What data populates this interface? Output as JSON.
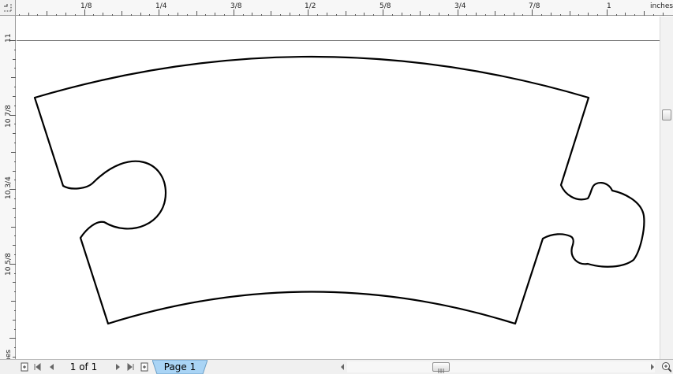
{
  "ruler": {
    "unit": "inches",
    "top_ticks": [
      "1/8",
      "1/4",
      "3/8",
      "1/2",
      "5/8",
      "3/4",
      "7/8",
      "1"
    ],
    "left_ticks": [
      "11",
      "10 7/8",
      "10 3/4",
      "10 5/8"
    ]
  },
  "status": {
    "page_count": "1 of 1",
    "page_tab": "Page 1"
  },
  "icons": {
    "add_page_before": "add-page-icon",
    "first": "first-page-icon",
    "prev": "previous-page-icon",
    "next": "next-page-icon",
    "last": "last-page-icon",
    "add_page_after": "add-page-icon",
    "scroll_left": "scroll-left-icon",
    "scroll_right": "scroll-right-icon",
    "zoom": "zoom-icon"
  },
  "colors": {
    "page_tab_fill": "#a9d4f5",
    "shape_stroke": "#000000"
  }
}
